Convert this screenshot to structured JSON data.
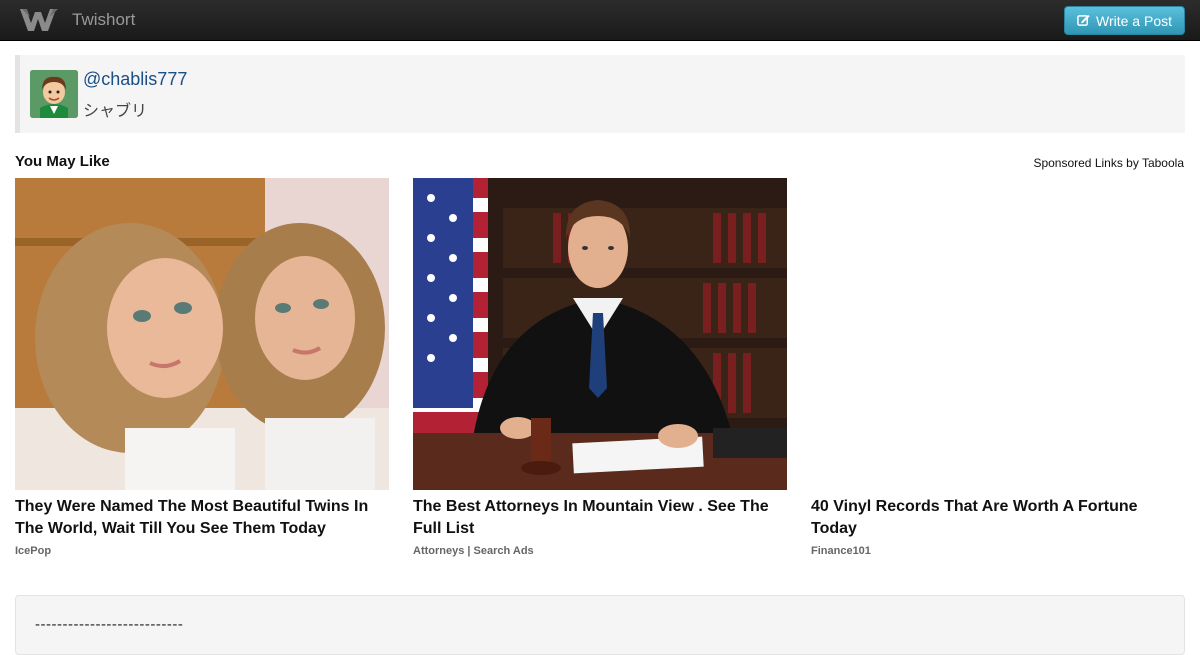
{
  "navbar": {
    "brand": "Twishort",
    "brand_icon": "twishort-logo-icon",
    "write_label": "Write a Post",
    "write_icon": "edit-icon"
  },
  "profile": {
    "handle": "@chablis777",
    "display_name": "シャブリ",
    "avatar": "avatar"
  },
  "recommendations": {
    "title": "You May Like",
    "sponsored": "Sponsored Links by Taboola",
    "items": [
      {
        "title": "They Were Named The Most Beautiful Twins In The World, Wait Till You See Them Today",
        "source": "IcePop"
      },
      {
        "title": "The Best Attorneys In Mountain View . See The Full List",
        "source": "Attorneys | Search Ads"
      },
      {
        "title": "40 Vinyl Records That Are Worth A Fortune Today",
        "source": "Finance101"
      }
    ]
  },
  "post": {
    "text": "---------------------------"
  },
  "colors": {
    "navbar": "#1f1f1f",
    "button": "#49afcd",
    "link": "#1a4f87",
    "panel": "#f5f5f5"
  }
}
